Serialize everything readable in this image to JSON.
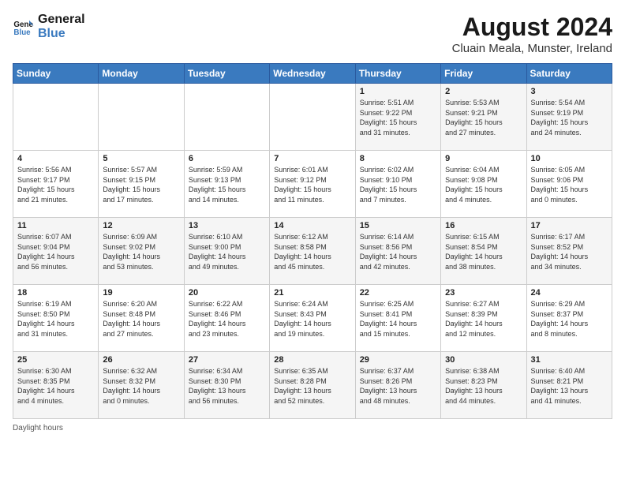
{
  "logo": {
    "line1": "General",
    "line2": "Blue"
  },
  "title": "August 2024",
  "subtitle": "Cluain Meala, Munster, Ireland",
  "days_of_week": [
    "Sunday",
    "Monday",
    "Tuesday",
    "Wednesday",
    "Thursday",
    "Friday",
    "Saturday"
  ],
  "weeks": [
    [
      {
        "day": "",
        "info": ""
      },
      {
        "day": "",
        "info": ""
      },
      {
        "day": "",
        "info": ""
      },
      {
        "day": "",
        "info": ""
      },
      {
        "day": "1",
        "info": "Sunrise: 5:51 AM\nSunset: 9:22 PM\nDaylight: 15 hours\nand 31 minutes."
      },
      {
        "day": "2",
        "info": "Sunrise: 5:53 AM\nSunset: 9:21 PM\nDaylight: 15 hours\nand 27 minutes."
      },
      {
        "day": "3",
        "info": "Sunrise: 5:54 AM\nSunset: 9:19 PM\nDaylight: 15 hours\nand 24 minutes."
      }
    ],
    [
      {
        "day": "4",
        "info": "Sunrise: 5:56 AM\nSunset: 9:17 PM\nDaylight: 15 hours\nand 21 minutes."
      },
      {
        "day": "5",
        "info": "Sunrise: 5:57 AM\nSunset: 9:15 PM\nDaylight: 15 hours\nand 17 minutes."
      },
      {
        "day": "6",
        "info": "Sunrise: 5:59 AM\nSunset: 9:13 PM\nDaylight: 15 hours\nand 14 minutes."
      },
      {
        "day": "7",
        "info": "Sunrise: 6:01 AM\nSunset: 9:12 PM\nDaylight: 15 hours\nand 11 minutes."
      },
      {
        "day": "8",
        "info": "Sunrise: 6:02 AM\nSunset: 9:10 PM\nDaylight: 15 hours\nand 7 minutes."
      },
      {
        "day": "9",
        "info": "Sunrise: 6:04 AM\nSunset: 9:08 PM\nDaylight: 15 hours\nand 4 minutes."
      },
      {
        "day": "10",
        "info": "Sunrise: 6:05 AM\nSunset: 9:06 PM\nDaylight: 15 hours\nand 0 minutes."
      }
    ],
    [
      {
        "day": "11",
        "info": "Sunrise: 6:07 AM\nSunset: 9:04 PM\nDaylight: 14 hours\nand 56 minutes."
      },
      {
        "day": "12",
        "info": "Sunrise: 6:09 AM\nSunset: 9:02 PM\nDaylight: 14 hours\nand 53 minutes."
      },
      {
        "day": "13",
        "info": "Sunrise: 6:10 AM\nSunset: 9:00 PM\nDaylight: 14 hours\nand 49 minutes."
      },
      {
        "day": "14",
        "info": "Sunrise: 6:12 AM\nSunset: 8:58 PM\nDaylight: 14 hours\nand 45 minutes."
      },
      {
        "day": "15",
        "info": "Sunrise: 6:14 AM\nSunset: 8:56 PM\nDaylight: 14 hours\nand 42 minutes."
      },
      {
        "day": "16",
        "info": "Sunrise: 6:15 AM\nSunset: 8:54 PM\nDaylight: 14 hours\nand 38 minutes."
      },
      {
        "day": "17",
        "info": "Sunrise: 6:17 AM\nSunset: 8:52 PM\nDaylight: 14 hours\nand 34 minutes."
      }
    ],
    [
      {
        "day": "18",
        "info": "Sunrise: 6:19 AM\nSunset: 8:50 PM\nDaylight: 14 hours\nand 31 minutes."
      },
      {
        "day": "19",
        "info": "Sunrise: 6:20 AM\nSunset: 8:48 PM\nDaylight: 14 hours\nand 27 minutes."
      },
      {
        "day": "20",
        "info": "Sunrise: 6:22 AM\nSunset: 8:46 PM\nDaylight: 14 hours\nand 23 minutes."
      },
      {
        "day": "21",
        "info": "Sunrise: 6:24 AM\nSunset: 8:43 PM\nDaylight: 14 hours\nand 19 minutes."
      },
      {
        "day": "22",
        "info": "Sunrise: 6:25 AM\nSunset: 8:41 PM\nDaylight: 14 hours\nand 15 minutes."
      },
      {
        "day": "23",
        "info": "Sunrise: 6:27 AM\nSunset: 8:39 PM\nDaylight: 14 hours\nand 12 minutes."
      },
      {
        "day": "24",
        "info": "Sunrise: 6:29 AM\nSunset: 8:37 PM\nDaylight: 14 hours\nand 8 minutes."
      }
    ],
    [
      {
        "day": "25",
        "info": "Sunrise: 6:30 AM\nSunset: 8:35 PM\nDaylight: 14 hours\nand 4 minutes."
      },
      {
        "day": "26",
        "info": "Sunrise: 6:32 AM\nSunset: 8:32 PM\nDaylight: 14 hours\nand 0 minutes."
      },
      {
        "day": "27",
        "info": "Sunrise: 6:34 AM\nSunset: 8:30 PM\nDaylight: 13 hours\nand 56 minutes."
      },
      {
        "day": "28",
        "info": "Sunrise: 6:35 AM\nSunset: 8:28 PM\nDaylight: 13 hours\nand 52 minutes."
      },
      {
        "day": "29",
        "info": "Sunrise: 6:37 AM\nSunset: 8:26 PM\nDaylight: 13 hours\nand 48 minutes."
      },
      {
        "day": "30",
        "info": "Sunrise: 6:38 AM\nSunset: 8:23 PM\nDaylight: 13 hours\nand 44 minutes."
      },
      {
        "day": "31",
        "info": "Sunrise: 6:40 AM\nSunset: 8:21 PM\nDaylight: 13 hours\nand 41 minutes."
      }
    ]
  ],
  "footer": "Daylight hours"
}
